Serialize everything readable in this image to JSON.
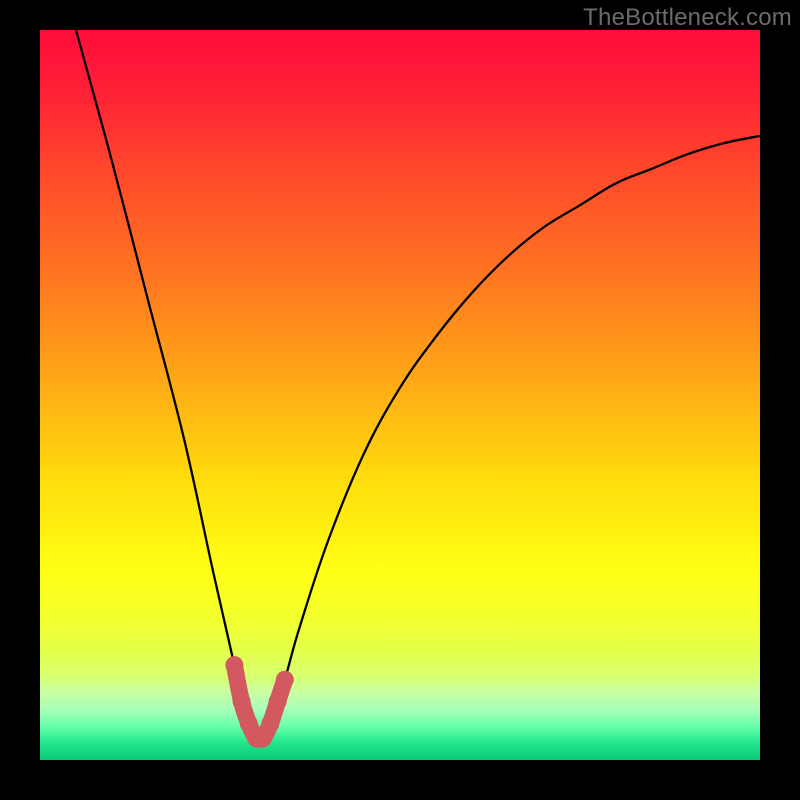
{
  "watermark": "TheBottleneck.com",
  "chart_data": {
    "type": "line",
    "title": "",
    "xlabel": "",
    "ylabel": "",
    "xlim": [
      0,
      100
    ],
    "ylim": [
      0,
      100
    ],
    "grid": false,
    "annotations": [],
    "series": [
      {
        "name": "bottleneck-curve",
        "color": "#000000",
        "x": [
          5,
          10,
          15,
          20,
          24,
          27,
          29,
          30,
          31,
          32,
          34,
          36,
          40,
          45,
          50,
          55,
          60,
          65,
          70,
          75,
          80,
          85,
          90,
          95,
          100
        ],
        "y": [
          100,
          82,
          63,
          44,
          26,
          13,
          5,
          3,
          3,
          5,
          11,
          18,
          30,
          42,
          51,
          58,
          64,
          69,
          73,
          76,
          79,
          81,
          83,
          84.5,
          85.5
        ]
      },
      {
        "name": "highlight-zone",
        "color": "#d1595f",
        "x": [
          27,
          28,
          29,
          30,
          30.5,
          31,
          32,
          33,
          34
        ],
        "y": [
          13,
          8,
          5,
          3,
          3,
          3,
          5,
          8,
          11
        ]
      }
    ],
    "background_gradient": {
      "stops": [
        {
          "offset": 0.0,
          "color": "#ff0d3a"
        },
        {
          "offset": 0.08,
          "color": "#ff1f36"
        },
        {
          "offset": 0.2,
          "color": "#ff4a2a"
        },
        {
          "offset": 0.35,
          "color": "#ff7a20"
        },
        {
          "offset": 0.5,
          "color": "#ffb015"
        },
        {
          "offset": 0.62,
          "color": "#ffde0c"
        },
        {
          "offset": 0.74,
          "color": "#ffff14"
        },
        {
          "offset": 0.8,
          "color": "#f4ff2a"
        },
        {
          "offset": 0.85,
          "color": "#e4ff4a"
        },
        {
          "offset": 0.885,
          "color": "#d8ff70"
        },
        {
          "offset": 0.905,
          "color": "#ccffa0"
        },
        {
          "offset": 0.93,
          "color": "#a8ffb8"
        },
        {
          "offset": 0.955,
          "color": "#66ffaa"
        },
        {
          "offset": 0.975,
          "color": "#25e88e"
        },
        {
          "offset": 1.0,
          "color": "#08c877"
        }
      ]
    }
  }
}
